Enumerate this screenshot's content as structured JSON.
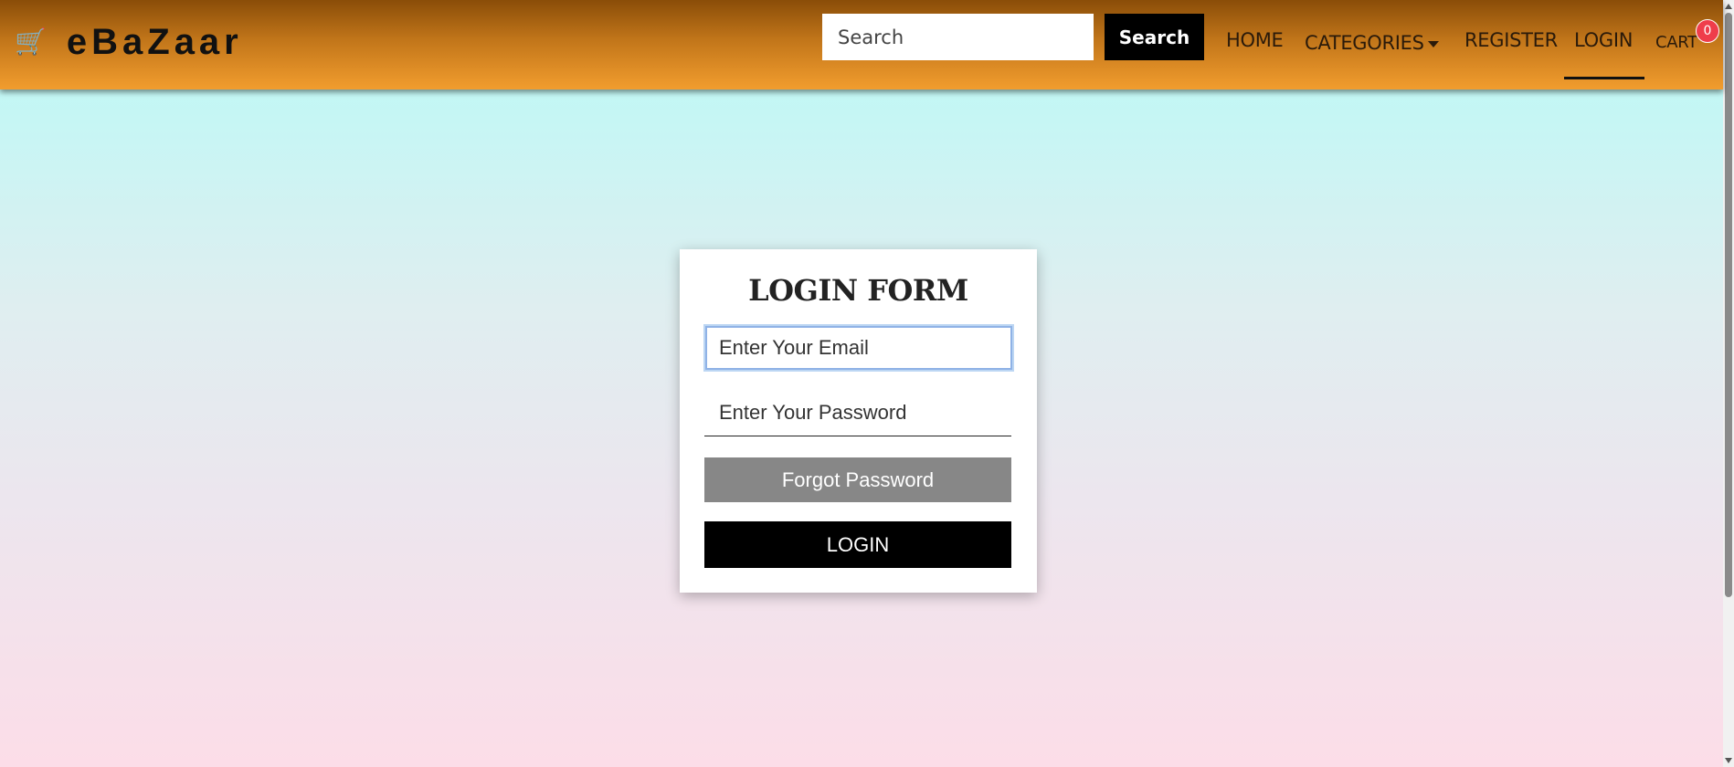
{
  "navbar": {
    "brand": {
      "icon": "shopping-cart-icon",
      "name": "eBaZaar"
    },
    "search": {
      "placeholder": "Search",
      "value": "",
      "button_label": "Search"
    },
    "links": {
      "home": "HOME",
      "categories": "CATEGORIES",
      "register": "REGISTER",
      "login": "LOGIN",
      "cart": "CART"
    },
    "active_link": "LOGIN",
    "cart_count": "0",
    "colors": {
      "gradient_top": "#8a4d08",
      "gradient_bottom": "#f29d2e",
      "badge": "#ef3d4b"
    }
  },
  "login_form": {
    "title": "LOGIN FORM",
    "email": {
      "placeholder": "Enter Your Email",
      "value": ""
    },
    "password": {
      "placeholder": "Enter Your Password",
      "value": ""
    },
    "forgot_label": "Forgot Password",
    "login_label": "LOGIN"
  },
  "page": {
    "background_top": "#b6fbf7",
    "background_bottom": "#fcdde8"
  }
}
